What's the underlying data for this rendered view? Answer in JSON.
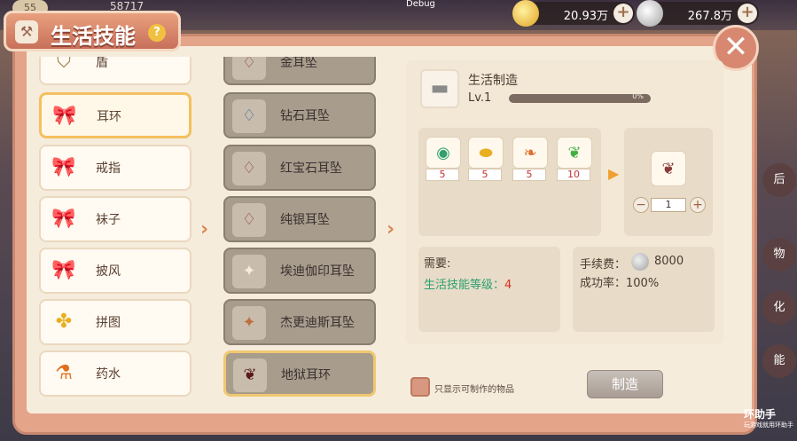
{
  "hud": {
    "level": "55",
    "exp": "58717",
    "debug": "Debug",
    "gold": "20.93万",
    "silver": "267.8万"
  },
  "window": {
    "title": "生活技能",
    "help": "?",
    "close": "✕"
  },
  "categories": [
    {
      "label": "盾",
      "icon": "shield-icon"
    },
    {
      "label": "耳环",
      "icon": "bow-icon",
      "selected": true
    },
    {
      "label": "戒指",
      "icon": "bow-icon"
    },
    {
      "label": "袜子",
      "icon": "bow-icon"
    },
    {
      "label": "披风",
      "icon": "bow-icon"
    },
    {
      "label": "拼图",
      "icon": "puzzle-icon"
    },
    {
      "label": "药水",
      "icon": "potion-icon"
    }
  ],
  "items": [
    {
      "label": "金耳坠",
      "icon": "earring-icon"
    },
    {
      "label": "钻石耳坠",
      "icon": "earring-icon"
    },
    {
      "label": "红宝石耳坠",
      "icon": "earring-icon"
    },
    {
      "label": "纯银耳坠",
      "icon": "earring-icon"
    },
    {
      "label": "埃迪伽印耳坠",
      "icon": "ribbon-icon"
    },
    {
      "label": "杰更迪斯耳坠",
      "icon": "ribbon-icon"
    },
    {
      "label": "地狱耳环",
      "icon": "horn-icon",
      "selected": true
    }
  ],
  "craft": {
    "name": "生活制造",
    "level": "Lv.1",
    "progress_text": "0%",
    "progress": 0,
    "materials": [
      {
        "icon": "orb-icon",
        "count": "5"
      },
      {
        "icon": "gold-ingot-icon",
        "count": "5"
      },
      {
        "icon": "feather-icon",
        "count": "5"
      },
      {
        "icon": "leaf-icon",
        "count": "10"
      }
    ],
    "quantity": "1",
    "minus": "−",
    "plus": "+",
    "requirement_title": "需要:",
    "requirement_label": "生活技能等级：",
    "requirement_value": "4",
    "fee_label": "手续费：",
    "fee_value": "8000",
    "success_label": "成功率：100%"
  },
  "footer": {
    "filter_label": "只显示可制作的物品",
    "make_button": "制造"
  },
  "watermark": {
    "title": "环助手",
    "sub": "玩游戏就用环助手"
  },
  "side": [
    "后",
    "物",
    "化",
    "能"
  ]
}
